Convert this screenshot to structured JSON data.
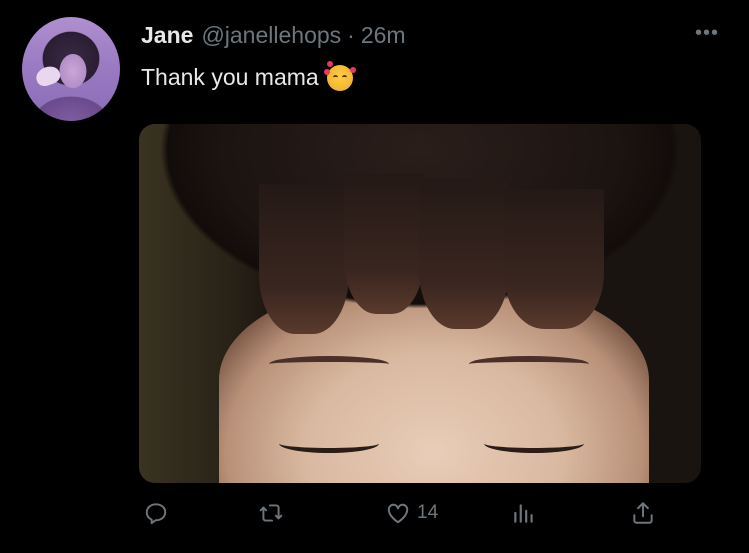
{
  "tweet": {
    "author_name": "Jane",
    "handle": "@janellehops",
    "separator": "·",
    "time": "26m",
    "text": "Thank you mama",
    "emoji": "smiling-face-with-hearts",
    "more_label": "•••",
    "likes": "14"
  },
  "colors": {
    "background": "#000000",
    "primary_text": "#e8e8e8",
    "secondary_text": "#6e767d"
  },
  "icons": [
    "reply-icon",
    "retweet-icon",
    "like-icon",
    "analytics-icon",
    "share-icon"
  ]
}
